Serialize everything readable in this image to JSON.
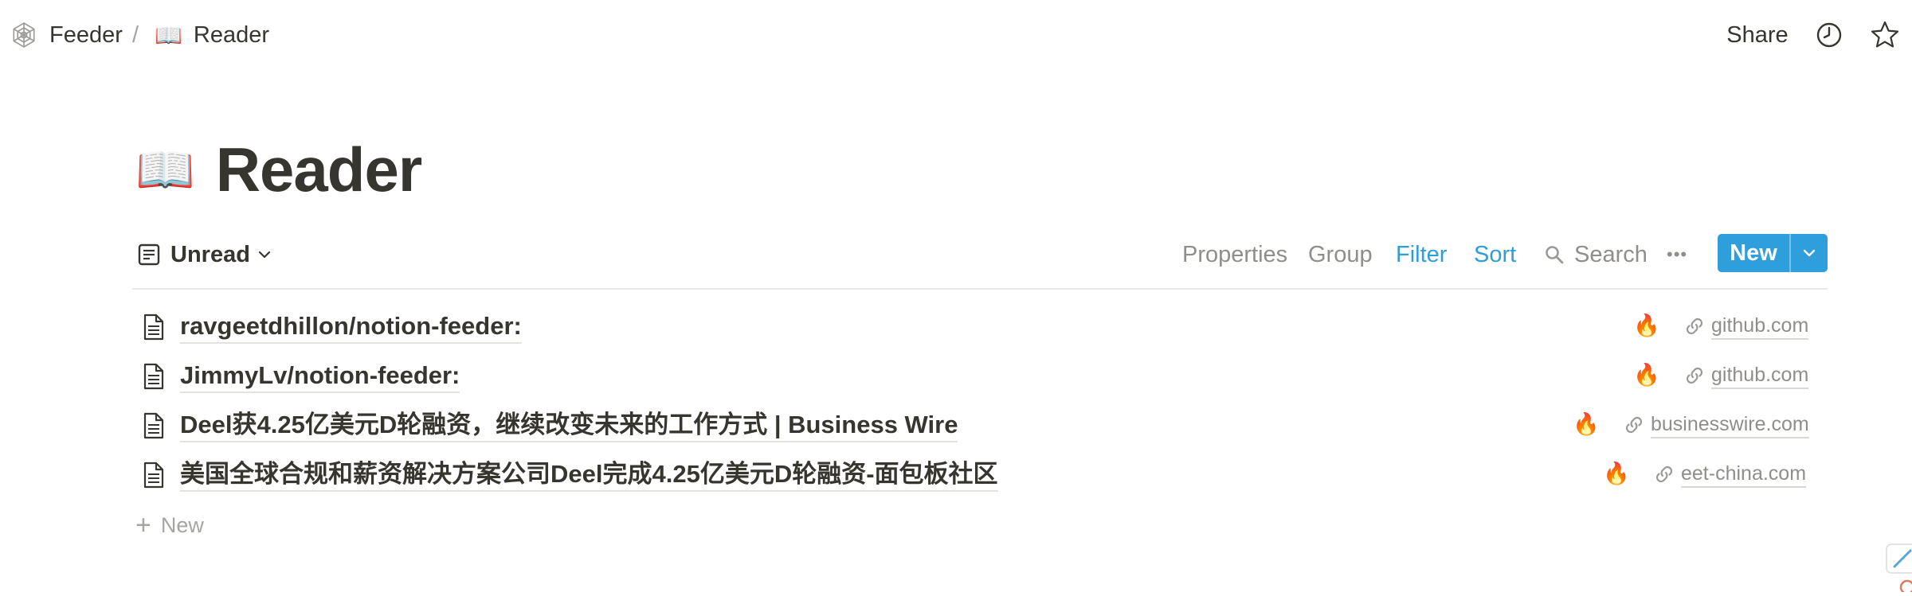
{
  "breadcrumb": {
    "workspace_icon": "spider-web-icon",
    "workspace_label": "Feeder",
    "separator": "/",
    "page_emoji": "📖",
    "page_label": "Reader"
  },
  "topbar": {
    "share_label": "Share",
    "history_icon": "clock-icon",
    "favorite_icon": "star-icon"
  },
  "page": {
    "emoji": "📖",
    "title": "Reader"
  },
  "view": {
    "icon": "list-view-icon",
    "name": "Unread",
    "properties_label": "Properties",
    "group_label": "Group",
    "filter_label": "Filter",
    "sort_label": "Sort",
    "search_label": "Search",
    "more_label": "•••",
    "new_label": "New"
  },
  "rows": [
    {
      "title": "ravgeetdhillon/notion-feeder:",
      "emoji": "🔥",
      "domain": "github.com"
    },
    {
      "title": "JimmyLv/notion-feeder:",
      "emoji": "🔥",
      "domain": "github.com"
    },
    {
      "title": "Deel获4.25亿美元D轮融资，继续改变未来的工作方式 | Business Wire",
      "emoji": "🔥",
      "domain": "businesswire.com"
    },
    {
      "title": "美国全球合规和薪资解决方案公司Deel完成4.25亿美元D轮融资-面包板社区",
      "emoji": "🔥",
      "domain": "eet-china.com"
    }
  ],
  "add_row": {
    "plus": "+",
    "label": "New"
  },
  "colors": {
    "text": "#37352f",
    "muted": "#8f8e8a",
    "accent": "#2e9fdb",
    "divider": "#e9e9e7"
  }
}
